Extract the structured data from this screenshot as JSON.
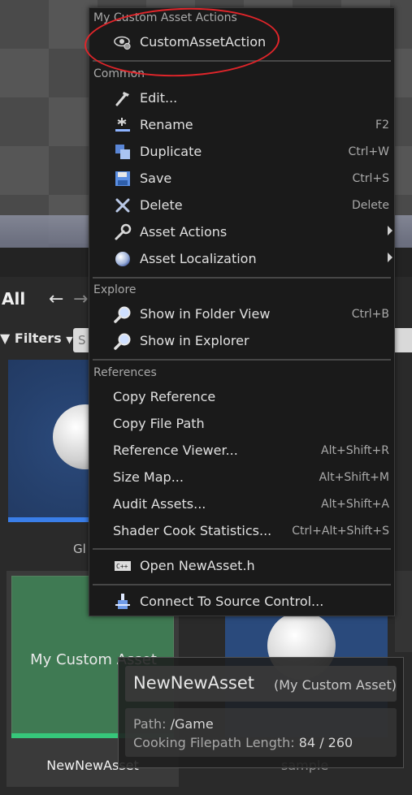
{
  "context_menu": {
    "custom_section": {
      "header": "My Custom Asset Actions",
      "items": [
        {
          "label": "CustomAssetAction",
          "icon": "eye-gear-icon"
        }
      ]
    },
    "common_section": {
      "header": "Common",
      "items": [
        {
          "label": "Edit...",
          "shortcut": "",
          "icon": "edit-icon"
        },
        {
          "label": "Rename",
          "shortcut": "F2",
          "icon": "rename-icon"
        },
        {
          "label": "Duplicate",
          "shortcut": "Ctrl+W",
          "icon": "duplicate-icon"
        },
        {
          "label": "Save",
          "shortcut": "Ctrl+S",
          "icon": "save-icon"
        },
        {
          "label": "Delete",
          "shortcut": "Delete",
          "icon": "delete-icon"
        },
        {
          "label": "Asset Actions",
          "shortcut": "",
          "icon": "wrench-icon",
          "submenu": true
        },
        {
          "label": "Asset Localization",
          "shortcut": "",
          "icon": "globe-icon",
          "submenu": true
        }
      ]
    },
    "explore_section": {
      "header": "Explore",
      "items": [
        {
          "label": "Show in Folder View",
          "shortcut": "Ctrl+B",
          "icon": "magnifier-icon"
        },
        {
          "label": "Show in Explorer",
          "shortcut": "",
          "icon": "magnifier-icon"
        }
      ]
    },
    "references_section": {
      "header": "References",
      "items": [
        {
          "label": "Copy Reference",
          "shortcut": ""
        },
        {
          "label": "Copy File Path",
          "shortcut": ""
        },
        {
          "label": "Reference Viewer...",
          "shortcut": "Alt+Shift+R"
        },
        {
          "label": "Size Map...",
          "shortcut": "Alt+Shift+M"
        },
        {
          "label": "Audit Assets...",
          "shortcut": "Alt+Shift+A"
        },
        {
          "label": "Shader Cook Statistics...",
          "shortcut": "Ctrl+Alt+Shift+S"
        }
      ]
    },
    "open_source": {
      "label": "Open NewAsset.h",
      "icon": "code-file-icon"
    },
    "source_control": {
      "label": "Connect To Source Control...",
      "icon": "source-control-icon"
    }
  },
  "content_browser": {
    "path": "All",
    "filters_label": "Filters",
    "search_placeholder": "S",
    "tiles": [
      {
        "label": "Gl",
        "thumb": "sphere"
      },
      {
        "label": "NewNewAsset",
        "thumb_text": "My Custom Asset"
      },
      {
        "label": "sample",
        "thumb": "sphere"
      }
    ]
  },
  "tooltip": {
    "name": "NewNewAsset",
    "type": "(My Custom Asset)",
    "path_label": "Path:",
    "path_value": "/Game",
    "cook_label": "Cooking Filepath Length:",
    "cook_value": "84 / 260"
  },
  "colors": {
    "annotation": "#e0252a",
    "custom_asset_bar": "#36c77a",
    "material_bar": "#3a7ee8"
  }
}
